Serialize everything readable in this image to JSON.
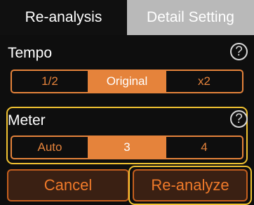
{
  "tabs": [
    {
      "label": "Re-analysis",
      "active": true
    },
    {
      "label": "Detail Setting",
      "active": false
    }
  ],
  "tempo": {
    "label": "Tempo",
    "help_icon": "?",
    "options": [
      "1/2",
      "Original",
      "x2"
    ],
    "selected": "Original"
  },
  "meter": {
    "label": "Meter",
    "help_icon": "?",
    "options": [
      "Auto",
      "3",
      "4"
    ],
    "selected": "3"
  },
  "actions": {
    "cancel_label": "Cancel",
    "reanalyze_label": "Re-analyze"
  },
  "colors": {
    "accent": "#e5833b",
    "highlight": "#f1c232",
    "inactive_tab": "#b9b9b9",
    "background": "#0e0e0e"
  }
}
